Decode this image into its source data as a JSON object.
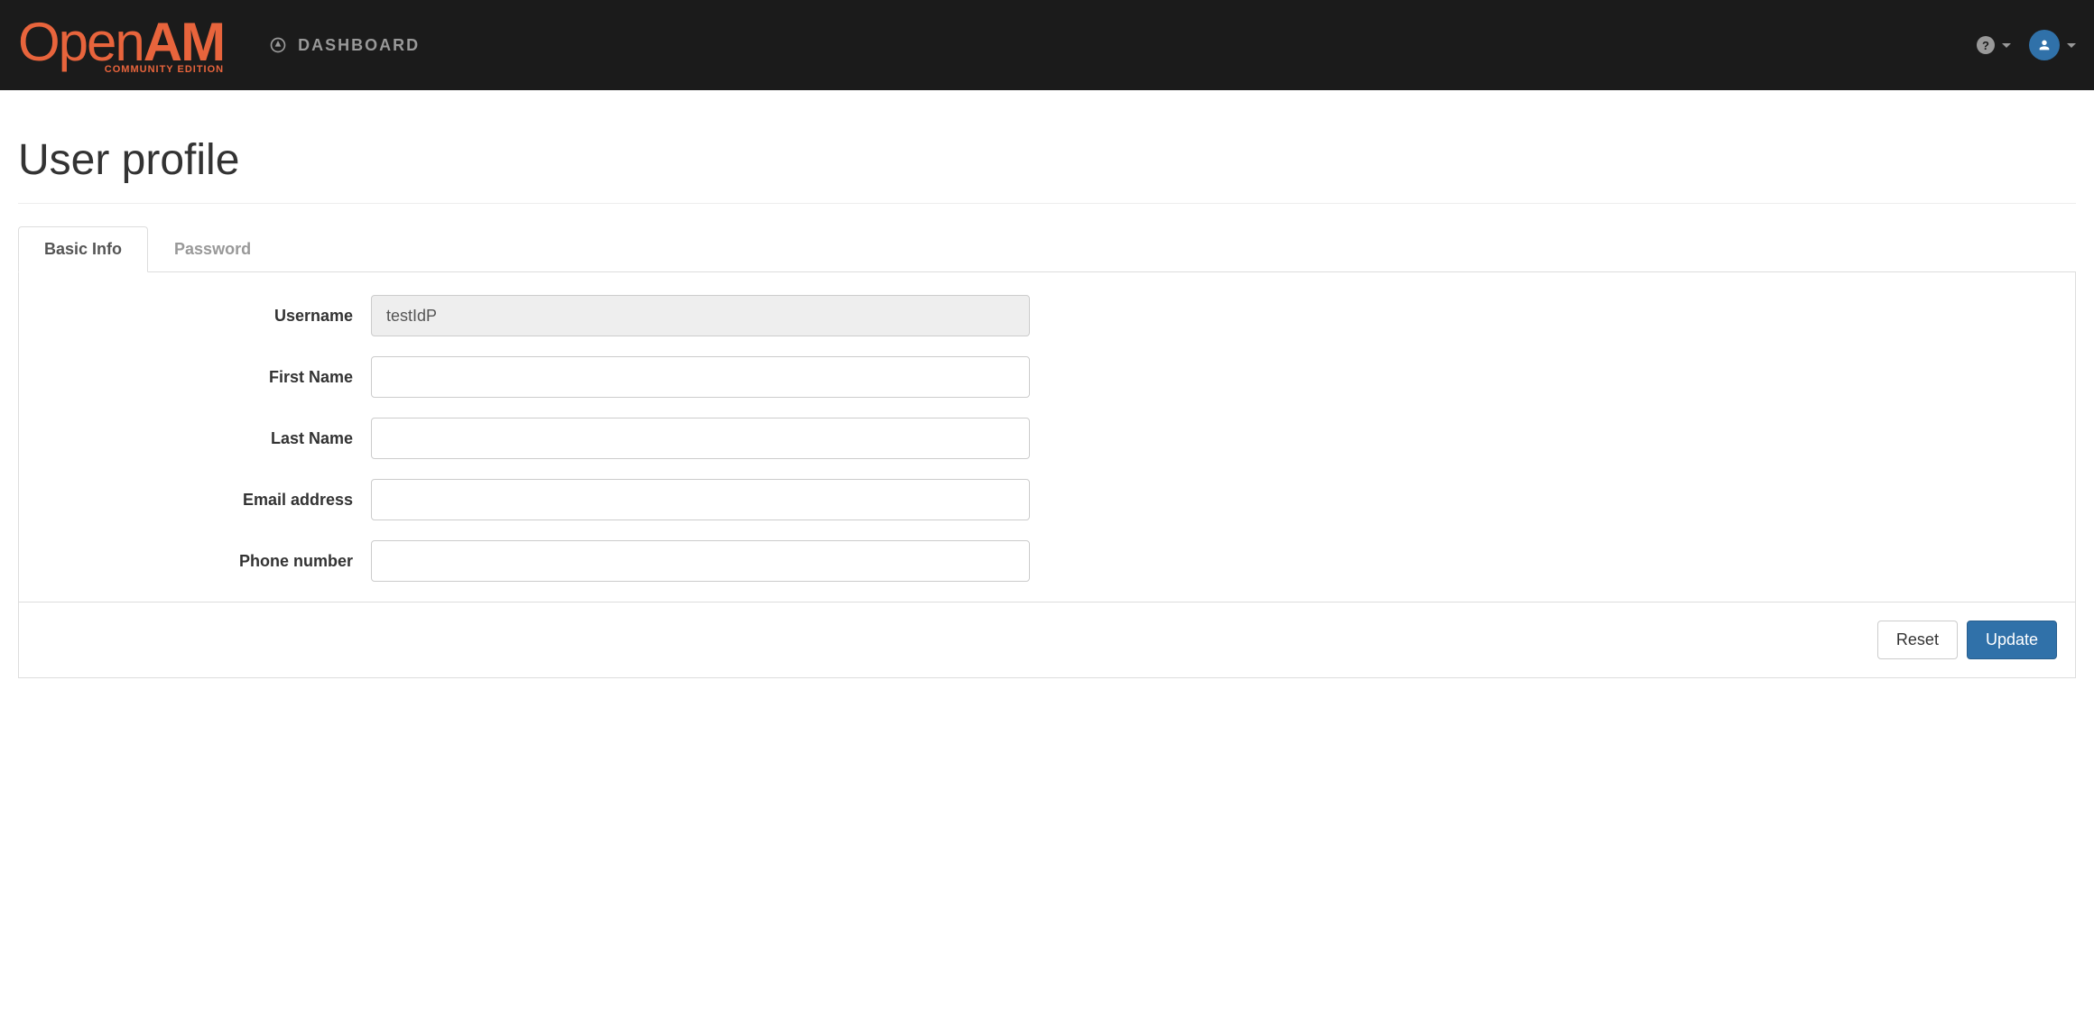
{
  "brand": {
    "part1": "Open",
    "part2": "AM",
    "tagline": "COMMUNITY EDITION"
  },
  "nav": {
    "dashboard_label": "DASHBOARD"
  },
  "page": {
    "title": "User profile"
  },
  "tabs": {
    "basic_info": "Basic Info",
    "password": "Password"
  },
  "form": {
    "fields": {
      "username": {
        "label": "Username",
        "value": "testIdP"
      },
      "first_name": {
        "label": "First Name",
        "value": ""
      },
      "last_name": {
        "label": "Last Name",
        "value": ""
      },
      "email": {
        "label": "Email address",
        "value": ""
      },
      "phone": {
        "label": "Phone number",
        "value": ""
      }
    },
    "buttons": {
      "reset": "Reset",
      "update": "Update"
    }
  }
}
